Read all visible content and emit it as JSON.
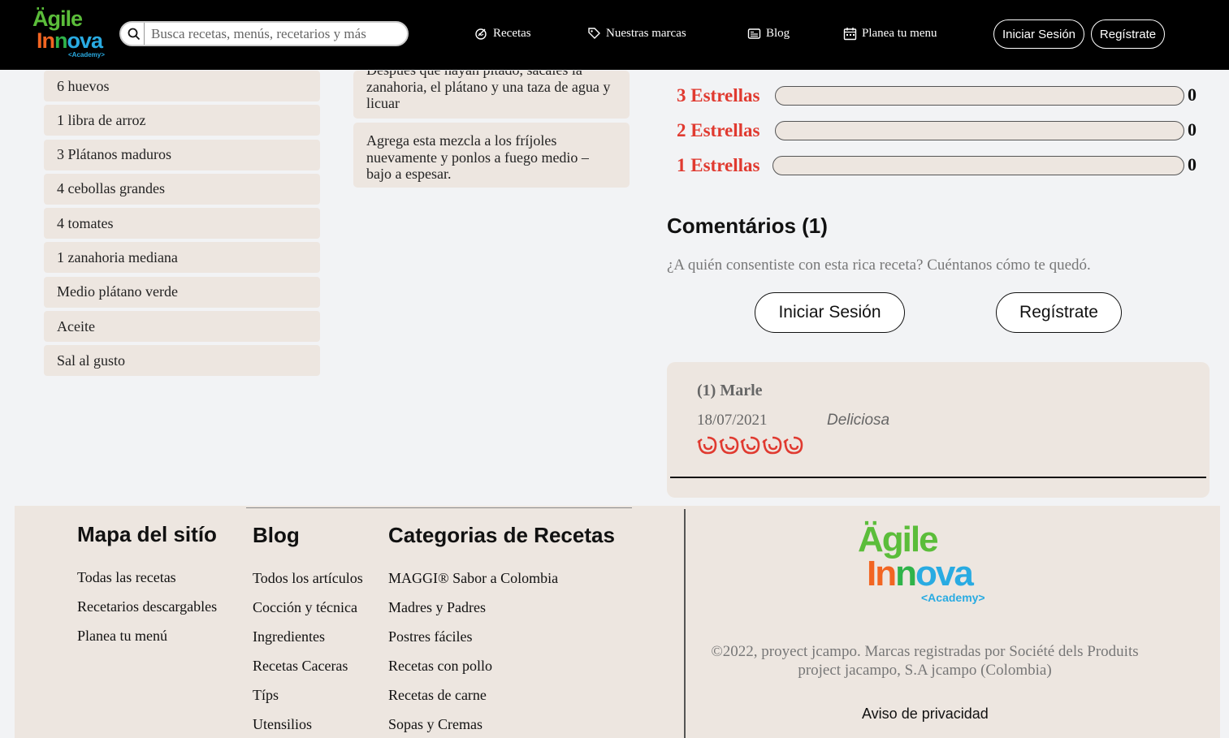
{
  "brand": {
    "logo_line1": "Ägile",
    "logo_line2_a": "In",
    "logo_line2_b": "n",
    "logo_line2_c": "ova",
    "logo_line3": "<Academy>"
  },
  "search": {
    "placeholder": "Busca recetas, menús, recetarios y más"
  },
  "nav": {
    "items": [
      {
        "label": "Recetas",
        "icon": "whisk-icon"
      },
      {
        "label": "Nuestras marcas",
        "icon": "tag-icon"
      },
      {
        "label": "Blog",
        "icon": "newspaper-icon"
      },
      {
        "label": "Planea tu menu",
        "icon": "calendar-icon"
      }
    ],
    "login_label": "Iniciar Sesión",
    "register_label": "Regístrate"
  },
  "ingredients": [
    "6 huevos",
    "1 libra de arroz",
    "3 Plátanos maduros",
    "4 cebollas grandes",
    "4 tomates",
    "1 zanahoria mediana",
    "Medio plátano verde",
    "Aceite",
    "Sal al gusto"
  ],
  "steps": [
    "Después que hayan pitado, sácales la zanahoria, el plátano y una taza de agua y licuar",
    "Agrega esta mezcla a los fríjoles nuevamente y ponlos a fuego medio – bajo a espesar."
  ],
  "ratings": [
    {
      "label": "3 Estrellas",
      "count": "0",
      "fraction": 0
    },
    {
      "label": "2 Estrellas",
      "count": "0",
      "fraction": 0
    },
    {
      "label": "1 Estrellas",
      "count": "0",
      "fraction": 0
    }
  ],
  "comments": {
    "title": "Comentários (1)",
    "prompt": "¿A quién consentiste con esta rica receta? Cuéntanos cómo te quedó.",
    "login_label": "Iniciar Sesión",
    "register_label": "Regístrate",
    "items": [
      {
        "author": "(1) Marle",
        "date": "18/07/2021",
        "text": "Deliciosa",
        "stars": 5
      }
    ]
  },
  "footer": {
    "sitemap": {
      "heading": "Mapa del sitío",
      "links": [
        "Todas las recetas",
        "Recetarios descargables",
        "Planea tu menú"
      ]
    },
    "blog": {
      "heading": "Blog",
      "links": [
        "Todos los artículos",
        "Cocción y técnica",
        "Ingredientes",
        "Recetas Caceras",
        "Típs",
        "Utensilios"
      ]
    },
    "categories": {
      "heading": "Categorias de Recetas",
      "links": [
        "MAGGI® Sabor a Colombia",
        "Madres y Padres",
        "Postres fáciles",
        "Recetas con pollo",
        "Recetas de carne",
        "Sopas y Cremas"
      ]
    },
    "copyright": "©2022, proyect jcampo. Marcas registradas por Société dels Produits project jacampo, S.A jcampo (Colombia)",
    "privacy": "Aviso de privacidad"
  },
  "colors": {
    "accent": "#e03a30",
    "card_bg": "#ede6e0",
    "nav_bg": "#000000"
  }
}
